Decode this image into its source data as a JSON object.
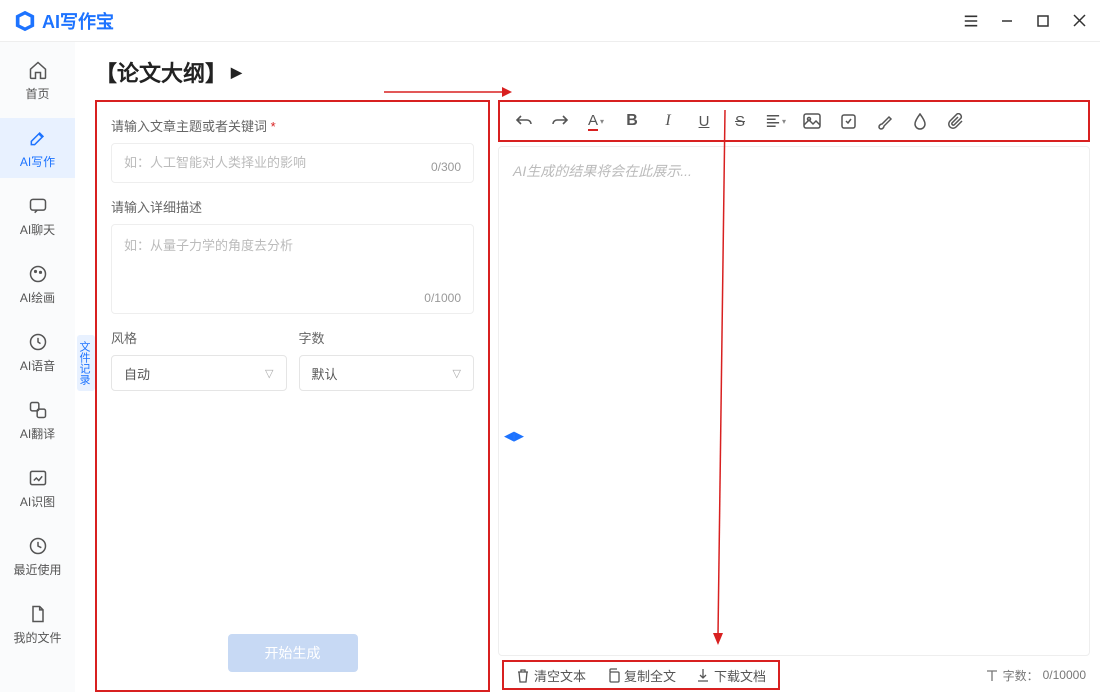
{
  "app": {
    "name": "AI写作宝"
  },
  "sidebar": {
    "items": [
      {
        "label": "首页"
      },
      {
        "label": "AI写作"
      },
      {
        "label": "AI聊天"
      },
      {
        "label": "AI绘画"
      },
      {
        "label": "AI语音"
      },
      {
        "label": "AI翻译"
      },
      {
        "label": "AI识图"
      },
      {
        "label": "最近使用"
      },
      {
        "label": "我的文件"
      }
    ]
  },
  "history_tab": "文件记录",
  "page": {
    "title": "【论文大纲】"
  },
  "form": {
    "topic_label": "请输入文章主题或者关键词",
    "topic_placeholder": "如：人工智能对人类择业的影响",
    "topic_counter": "0/300",
    "detail_label": "请输入详细描述",
    "detail_placeholder": "如：从量子力学的角度去分析",
    "detail_counter": "0/1000",
    "style_label": "风格",
    "style_value": "自动",
    "count_label": "字数",
    "count_value": "默认",
    "generate": "开始生成"
  },
  "editor": {
    "placeholder": "AI生成的结果将会在此展示..."
  },
  "bottom": {
    "clear": "清空文本",
    "copy": "复制全文",
    "download": "下载文档",
    "wc_label": "字数：",
    "wc_value": "0/10000"
  }
}
